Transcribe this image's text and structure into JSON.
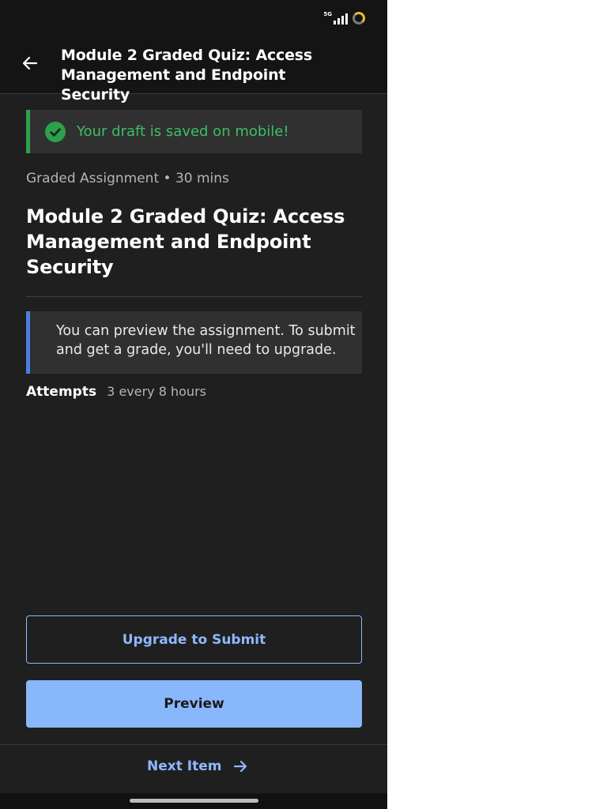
{
  "status_bar": {
    "network": "5G",
    "signal_icon": "signal-bars-icon",
    "battery_icon": "battery-ring-icon",
    "battery_color": "#f2b632"
  },
  "header": {
    "back_icon": "arrow-left-icon",
    "title": "Module 2 Graded Quiz: Access Management and Endpoint Security"
  },
  "draft_banner": {
    "icon": "check-circle-icon",
    "text": "Your draft is saved on mobile!",
    "accent_color": "#2ba14b"
  },
  "assignment": {
    "meta": "Graded Assignment • 30 mins",
    "title": "Module 2 Graded Quiz: Access Management and Endpoint Security"
  },
  "info_box": {
    "text": "You can preview the assignment. To submit and get a grade, you'll need to upgrade.",
    "accent_color": "#4a7fe0"
  },
  "attempts": {
    "label": "Attempts",
    "value": "3 every 8 hours"
  },
  "actions": {
    "upgrade_label": "Upgrade to Submit",
    "preview_label": "Preview"
  },
  "footer": {
    "next_label": "Next Item",
    "next_icon": "arrow-right-icon"
  },
  "colors": {
    "background": "#1f1f1f",
    "link_blue": "#8fb8ff",
    "button_fill": "#89b7fb"
  }
}
